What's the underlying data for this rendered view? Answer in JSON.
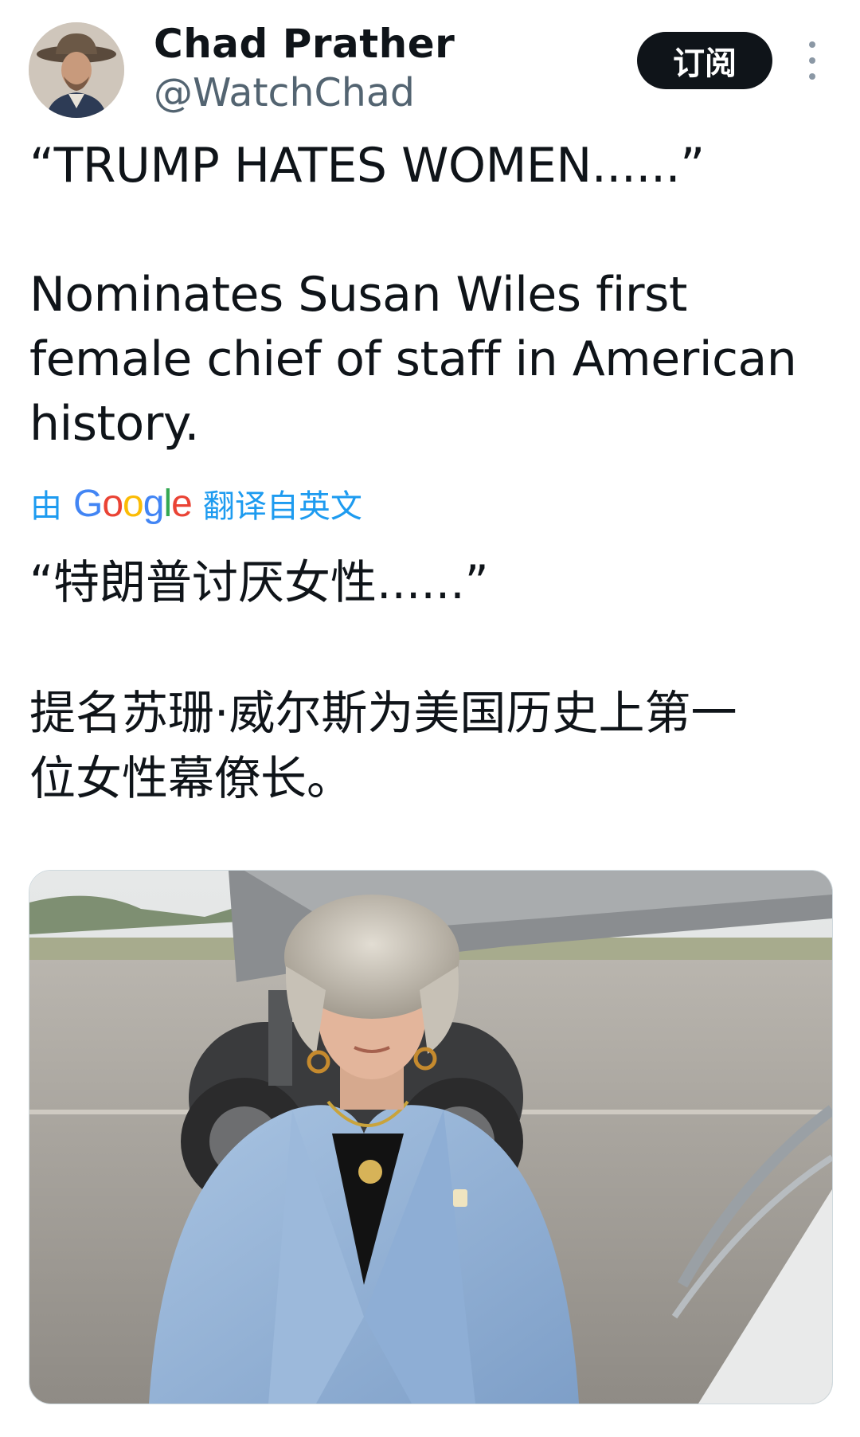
{
  "author": {
    "display_name": "Chad Prather",
    "handle": "@WatchChad"
  },
  "header": {
    "subscribe_label": "订阅",
    "more_icon": "more-vertical-icon"
  },
  "tweet": {
    "text": "“TRUMP HATES WOMEN......”\n\nNominates Susan Wiles first\nfemale chief of staff in American\nhistory."
  },
  "translation": {
    "prefix": "由",
    "provider": "Google",
    "suffix": "翻译自英文",
    "text": "“特朗普讨厌女性......”\n\n提名苏珊·威尔斯为美国历史上第一\n位女性幕僚长。"
  },
  "colors": {
    "link_blue": "#1d9bf0",
    "button_dark": "#0f1419",
    "secondary_text": "#536471"
  }
}
